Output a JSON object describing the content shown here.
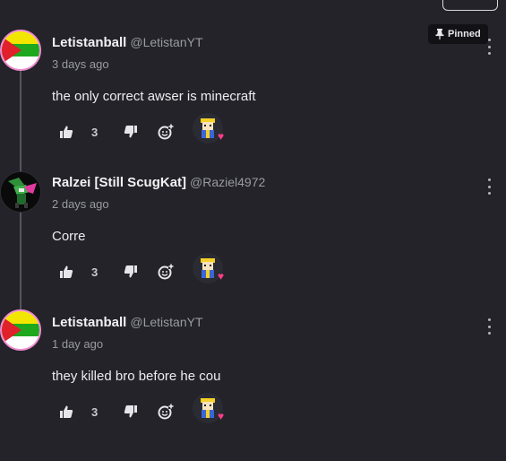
{
  "top_button": {
    "label": ""
  },
  "comments": [
    {
      "author": "Letistanball",
      "handle": "@LetistanYT",
      "time": "3 days ago",
      "text": "the only correct awser is minecraft",
      "pinned": true,
      "pinned_label": "Pinned",
      "likes": "3",
      "avatar": "flag-avatar"
    },
    {
      "author": "Ralzei [Still ScugKat]",
      "handle": "@Raziel4972",
      "time": "2 days ago",
      "text": "Corre",
      "pinned": false,
      "likes": "3",
      "avatar": "character-avatar"
    },
    {
      "author": "Letistanball",
      "handle": "@LetistanYT",
      "time": "1 day ago",
      "text": "they killed bro before he cou",
      "pinned": false,
      "likes": "3",
      "avatar": "flag-avatar"
    }
  ],
  "colors": {
    "background": "#232329",
    "heart": "#ff3d8a",
    "avatar_border": "#f08ad0"
  },
  "icons": [
    "thumbs-up-icon",
    "thumbs-down-icon",
    "add-reaction-icon",
    "pin-icon",
    "more-options-icon",
    "heart-icon"
  ]
}
